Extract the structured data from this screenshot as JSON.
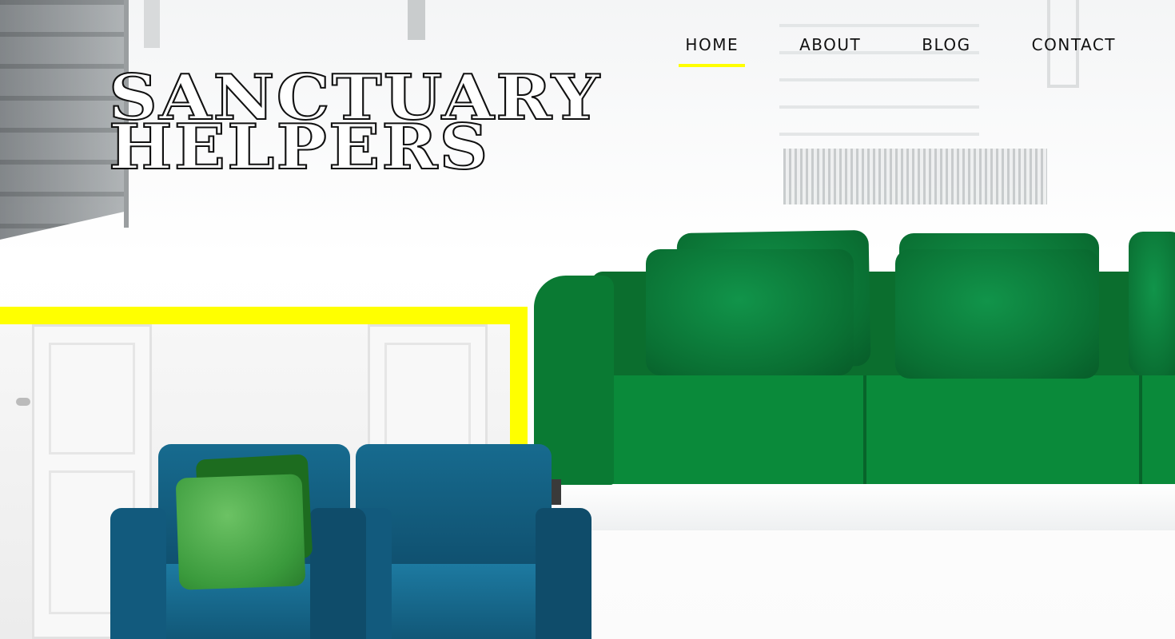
{
  "nav": {
    "items": [
      {
        "label": "HOME",
        "active": true
      },
      {
        "label": "ABOUT",
        "active": false
      },
      {
        "label": "BLOG",
        "active": false
      },
      {
        "label": "CONTACT",
        "active": false
      }
    ]
  },
  "logo": {
    "line1": "SANCTUARY",
    "line2": "HELPERS"
  },
  "colors": {
    "accent": "#ffff00",
    "sofa": "#0a8a3a",
    "chairs": "#176b8f",
    "text": "#111111"
  }
}
